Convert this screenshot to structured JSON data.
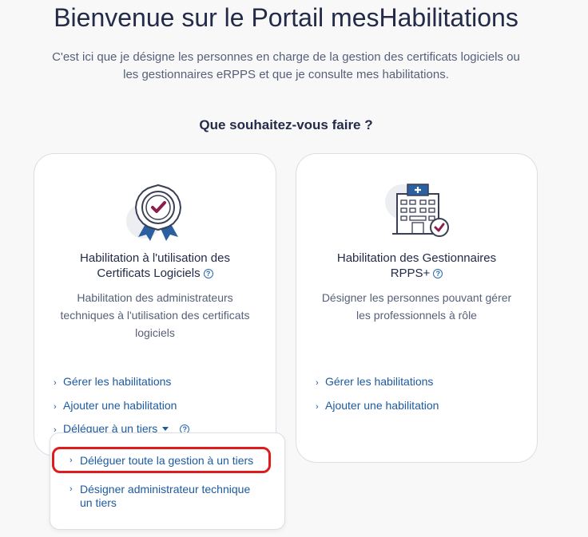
{
  "header": {
    "title": "Bienvenue sur le Portail mesHabilitations",
    "subtitle_line1": "C'est ici que je désigne les personnes en charge de la gestion des certificats logiciels ou",
    "subtitle_line2": "les gestionnaires eRPPS et que je consulte mes habilitations.",
    "question": "Que souhaitez-vous faire ?"
  },
  "cards": [
    {
      "icon": "certificate-badge-icon",
      "title_line1": "Habilitation à l'utilisation des",
      "title_line2": "Certificats Logiciels",
      "desc_line1": "Habilitation des administrateurs",
      "desc_line2": "techniques à l'utilisation des certificats",
      "desc_line3": "logiciels",
      "links": [
        "Gérer les habilitations",
        "Ajouter une habilitation",
        "Déléguer à un tiers"
      ]
    },
    {
      "icon": "hospital-check-icon",
      "title_line1": "Habilitation des Gestionnaires",
      "title_line2": "RPPS+",
      "desc_line1": "Désigner les personnes pouvant gérer",
      "desc_line2": "les professionnels à rôle",
      "links": [
        "Gérer les habilitations",
        "Ajouter une habilitation"
      ]
    }
  ],
  "dropdown": {
    "items": [
      {
        "line1": "Déléguer toute la gestion à un tiers",
        "line2": ""
      },
      {
        "line1": "Désigner administrateur technique",
        "line2": "un tiers"
      }
    ],
    "highlighted_index": 0,
    "highlight_color": "#e01b1b"
  },
  "colors": {
    "link": "#1d5aa0",
    "title": "#232b49",
    "text": "#566079",
    "accent_check": "#8d1d4a"
  }
}
